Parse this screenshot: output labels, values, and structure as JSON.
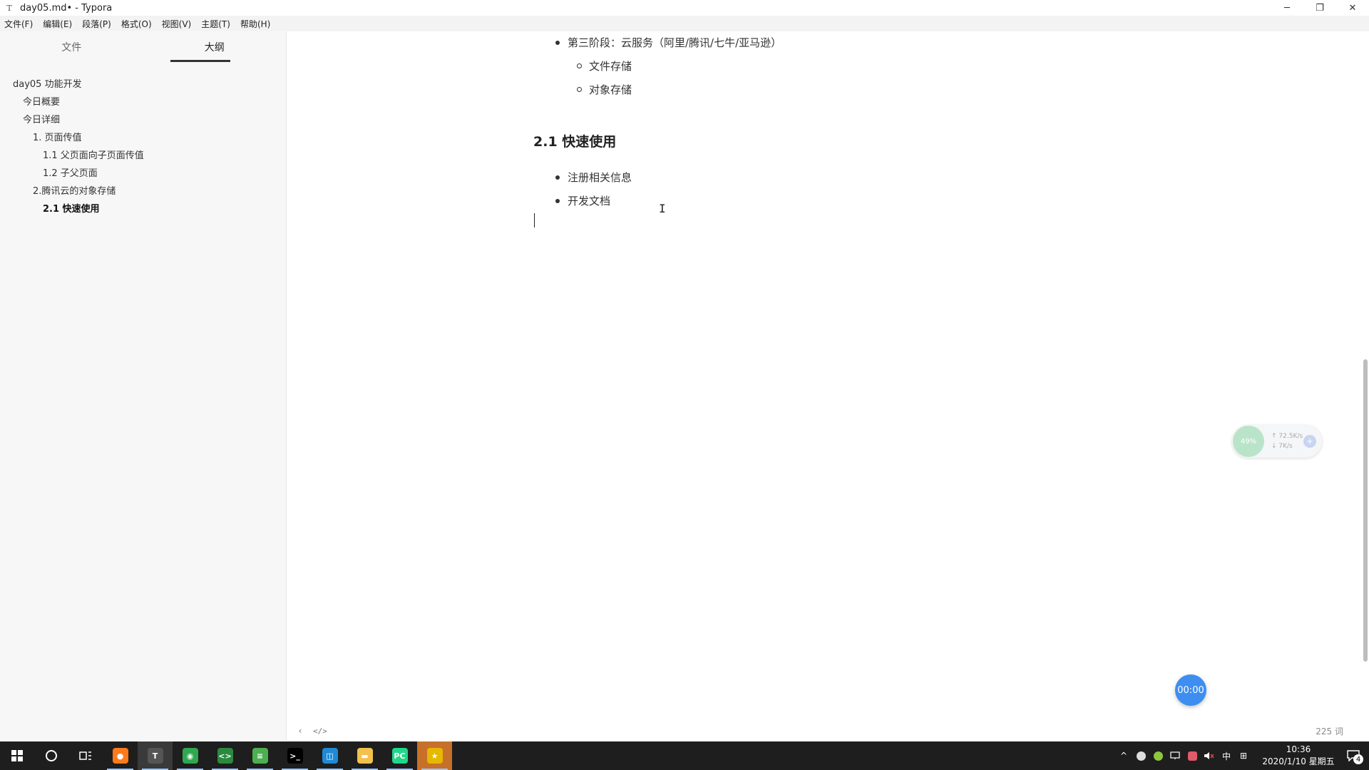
{
  "window": {
    "title": "day05.md• - Typora",
    "app_icon_glyph": "T",
    "controls": {
      "minimize": "─",
      "restore": "❐",
      "close": "✕"
    }
  },
  "menubar": {
    "items": [
      "文件(F)",
      "编辑(E)",
      "段落(P)",
      "格式(O)",
      "视图(V)",
      "主题(T)",
      "帮助(H)"
    ]
  },
  "sidebar": {
    "tabs": [
      "文件",
      "大纲"
    ],
    "active_tab": "大纲",
    "outline": [
      {
        "label": "day05 功能开发",
        "level": 1
      },
      {
        "label": "今日概要",
        "level": 2
      },
      {
        "label": "今日详细",
        "level": 2
      },
      {
        "label": "1. 页面传值",
        "level": 3
      },
      {
        "label": "1.1 父页面向子页面传值",
        "level": 4
      },
      {
        "label": "1.2 子父页面",
        "level": 4
      },
      {
        "label": "2.腾讯云的对象存储",
        "level": 3
      },
      {
        "label": "2.1 快速使用",
        "level": 4,
        "active": true
      }
    ]
  },
  "editor": {
    "bullet_stage3": "第三阶段：云服务（阿里/腾讯/七牛/亚马逊）",
    "sub_file_storage": "文件存储",
    "sub_object_storage": "对象存储",
    "heading": "2.1 快速使用",
    "bullet_register": "注册相关信息",
    "bullet_docs": "开发文档"
  },
  "footer": {
    "back_glyph": "‹",
    "source_glyph": "</>",
    "word_count": "225 词"
  },
  "widgets": {
    "net_percent": "49%",
    "upload_speed": "↑ 72.5K/s",
    "download_speed": "↓ 7K/s",
    "net_plus": "+",
    "timer": "00:00"
  },
  "taskbar": {
    "apps": [
      {
        "name": "firefox",
        "glyph": "●",
        "color": "#ff7a1a",
        "running": true
      },
      {
        "name": "typora",
        "glyph": "T",
        "color": "#555555",
        "running": true,
        "active": true
      },
      {
        "name": "chrome",
        "glyph": "◉",
        "color": "#2fa84f",
        "running": true
      },
      {
        "name": "code-editor",
        "glyph": "<>",
        "color": "#2b8a3e",
        "running": true
      },
      {
        "name": "notepad",
        "glyph": "≡",
        "color": "#4caf50",
        "running": true
      },
      {
        "name": "terminal",
        "glyph": ">_",
        "color": "#000000",
        "running": true
      },
      {
        "name": "remote",
        "glyph": "◫",
        "color": "#1f8ad6",
        "running": true
      },
      {
        "name": "explorer",
        "glyph": "▬",
        "color": "#f2c14e",
        "running": true
      },
      {
        "name": "pycharm",
        "glyph": "PC",
        "color": "#21d789",
        "running": true
      },
      {
        "name": "pinned-star",
        "glyph": "★",
        "color": "#e6b800",
        "running": true,
        "highlight": true
      }
    ],
    "tray": {
      "chevron": "^",
      "ime": "中",
      "keyboard": "⊞",
      "time": "10:36",
      "date": "2020/1/10 星期五",
      "notif_count": "4"
    }
  }
}
